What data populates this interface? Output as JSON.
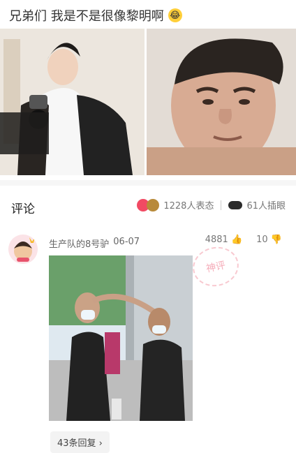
{
  "post": {
    "title": "兄弟们 我是不是很像黎明啊",
    "emoji_icon": "rolling-laughing-icon"
  },
  "comments_section": {
    "title": "评论",
    "reactions_count_label": "1228人表态",
    "viewers_count_label": "61人插眼"
  },
  "comment": {
    "username": "生产队的8号驴",
    "date": "06-07",
    "like_count": "4881",
    "dislike_count": "10",
    "stamp_text": "神评",
    "replies_label": "43条回复 ›"
  },
  "colors": {
    "accent": "#f14a63",
    "stamp": "#f28a9c"
  }
}
